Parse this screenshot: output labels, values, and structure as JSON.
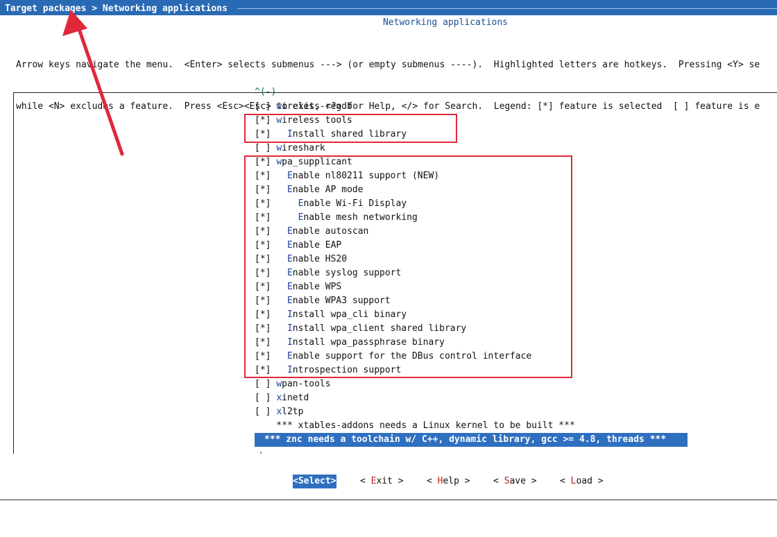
{
  "breadcrumb": {
    "text": "Target packages > Networking applications",
    "part1": "Target packages",
    "sep": " > ",
    "part2": "Networking applications"
  },
  "panel_title": "Networking applications",
  "help": {
    "line1": "Arrow keys navigate the menu.  <Enter> selects submenus ---> (or empty submenus ----).  Highlighted letters are hotkeys.  Pressing <Y> se",
    "line2": "while <N> excludes a feature.  Press <Esc><Esc> to exit, <?> for Help, </> for Search.  Legend: [*] feature is selected  [ ] feature is e"
  },
  "scroll": {
    "top": "^(-)",
    "bottom": "·"
  },
  "menu": [
    {
      "mark": "[ ] ",
      "indent": "",
      "hk": "w",
      "rest": "ireless-regdb"
    },
    {
      "mark": "[*] ",
      "indent": "",
      "hk": "w",
      "rest": "ireless tools"
    },
    {
      "mark": "[*] ",
      "indent": "  ",
      "hk": "I",
      "rest": "nstall shared library"
    },
    {
      "mark": "[ ] ",
      "indent": "",
      "hk": "w",
      "rest": "ireshark"
    },
    {
      "mark": "[*] ",
      "indent": "",
      "hk": "w",
      "rest": "pa_supplicant"
    },
    {
      "mark": "[*] ",
      "indent": "  ",
      "hk": "E",
      "rest": "nable nl80211 support (NEW)"
    },
    {
      "mark": "[*] ",
      "indent": "  ",
      "hk": "E",
      "rest": "nable AP mode"
    },
    {
      "mark": "[*] ",
      "indent": "    ",
      "hk": "E",
      "rest": "nable Wi-Fi Display"
    },
    {
      "mark": "[*] ",
      "indent": "    ",
      "hk": "E",
      "rest": "nable mesh networking"
    },
    {
      "mark": "[*] ",
      "indent": "  ",
      "hk": "E",
      "rest": "nable autoscan"
    },
    {
      "mark": "[*] ",
      "indent": "  ",
      "hk": "E",
      "rest": "nable EAP"
    },
    {
      "mark": "[*] ",
      "indent": "  ",
      "hk": "E",
      "rest": "nable HS20"
    },
    {
      "mark": "[*] ",
      "indent": "  ",
      "hk": "E",
      "rest": "nable syslog support"
    },
    {
      "mark": "[*] ",
      "indent": "  ",
      "hk": "E",
      "rest": "nable WPS"
    },
    {
      "mark": "[*] ",
      "indent": "  ",
      "hk": "E",
      "rest": "nable WPA3 support"
    },
    {
      "mark": "[*] ",
      "indent": "  ",
      "hk": "I",
      "rest": "nstall wpa_cli binary"
    },
    {
      "mark": "[*] ",
      "indent": "  ",
      "hk": "I",
      "rest": "nstall wpa_client shared library"
    },
    {
      "mark": "[*] ",
      "indent": "  ",
      "hk": "I",
      "rest": "nstall wpa_passphrase binary"
    },
    {
      "mark": "[*] ",
      "indent": "  ",
      "hk": "E",
      "rest": "nable support for the DBus control interface"
    },
    {
      "mark": "[*] ",
      "indent": "  ",
      "hk": "I",
      "rest": "ntrospection support"
    },
    {
      "mark": "[ ] ",
      "indent": "",
      "hk": "w",
      "rest": "pan-tools"
    },
    {
      "mark": "[ ] ",
      "indent": "",
      "hk": "x",
      "rest": "inetd"
    },
    {
      "mark": "[ ] ",
      "indent": "",
      "hk": "x",
      "rest": "l2tp"
    }
  ],
  "comments": {
    "xtables": "    *** xtables-addons needs a Linux kernel to be built ***",
    "znc": "*** znc needs a toolchain w/ C++, dynamic library, gcc >= 4.8, threads ***"
  },
  "buttons": {
    "select": {
      "open": "<",
      "hk": "S",
      "rest": "elect",
      "close": ">"
    },
    "exit": {
      "open": "< ",
      "hk": "E",
      "rest": "xit",
      "close": " >"
    },
    "help": {
      "open": "< ",
      "hk": "H",
      "rest": "elp",
      "close": " >"
    },
    "save": {
      "open": "< ",
      "hk": "S",
      "rest": "ave",
      "close": " >"
    },
    "load": {
      "open": "< ",
      "hk": "L",
      "rest": "oad",
      "close": " >"
    }
  },
  "colors": {
    "title_bar": "#2a6ab4",
    "selection": "#2f6fbf",
    "annotation_red": "#e0283a"
  }
}
